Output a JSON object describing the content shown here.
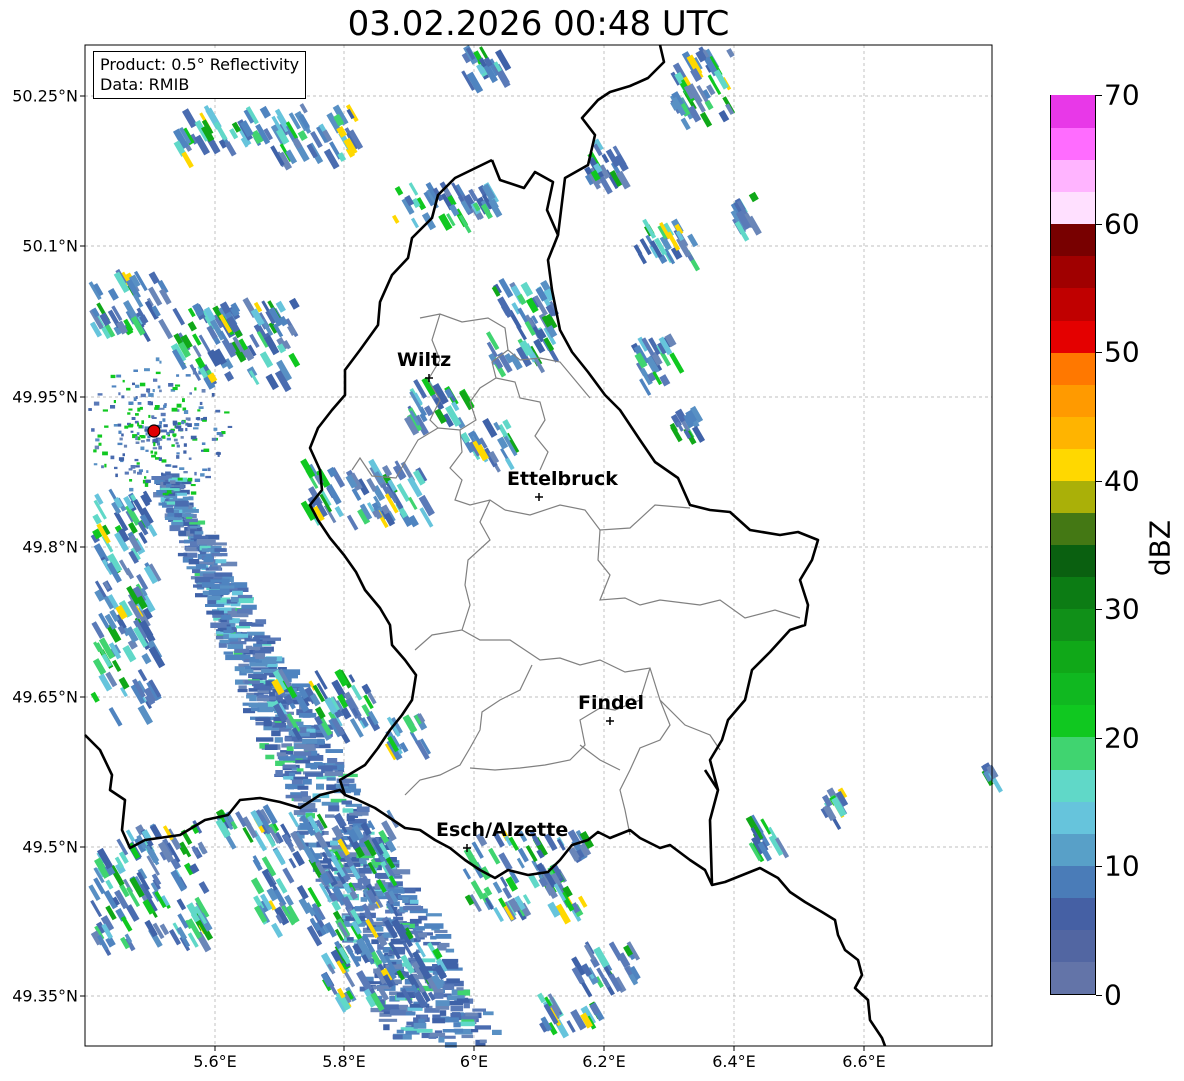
{
  "title": "03.02.2026 00:48 UTC",
  "info_box": {
    "product": "Product: 0.5° Reflectivity",
    "data": "Data: RMIB"
  },
  "axes": {
    "x_ticks": [
      "5.6°E",
      "5.8°E",
      "6°E",
      "6.2°E",
      "6.4°E",
      "6.6°E"
    ],
    "y_ticks": [
      "50.25°N",
      "50.1°N",
      "49.95°N",
      "49.8°N",
      "49.65°N",
      "49.5°N",
      "49.35°N"
    ]
  },
  "cities": [
    {
      "name": "Wiltz"
    },
    {
      "name": "Ettelbruck"
    },
    {
      "name": "Findel"
    },
    {
      "name": "Esch/Alzette"
    }
  ],
  "colorbar": {
    "label": "dBZ",
    "ticks": [
      "0",
      "10",
      "20",
      "30",
      "40",
      "50",
      "60",
      "70"
    ],
    "colors": [
      "#6374a8",
      "#5266a2",
      "#4560a4",
      "#4a7cb8",
      "#58a0c8",
      "#66c4dc",
      "#60d8c8",
      "#40d470",
      "#10c820",
      "#10b820",
      "#10a818",
      "#109018",
      "#0c7c14",
      "#0a6010",
      "#447814",
      "#aab008",
      "#ffd800",
      "#ffb400",
      "#ff9a00",
      "#ff7800",
      "#e40000",
      "#c00000",
      "#a00000",
      "#780000",
      "#ffe0ff",
      "#ffb4ff",
      "#ff6cff",
      "#e838e8"
    ]
  },
  "colors": {
    "border": "#000000",
    "admin": "#808080",
    "radar_site": "#e00000"
  }
}
